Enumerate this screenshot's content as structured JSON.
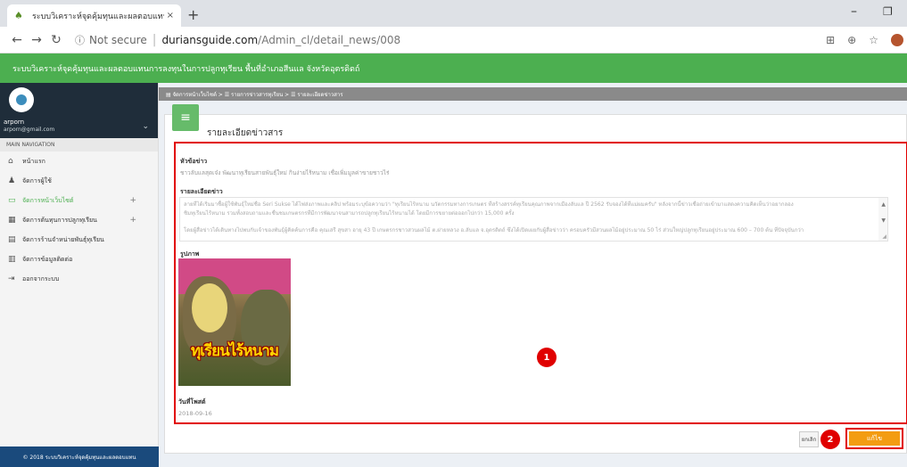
{
  "browser": {
    "tab_title": "ระบบวิเคราะห์จุดคุ้มทุนและผลตอบแทน",
    "tab_close": "×",
    "new_tab": "+",
    "not_secure": "Not secure",
    "url_host": "duriansguide.com",
    "url_path": "/Admin_cl/detail_news/008"
  },
  "app": {
    "header_title": "ระบบวิเคราะห์จุดคุ้มทุนและผลตอบแทนการลงทุนในการปลูกทุเรียน พื้นที่อำเภอสีนแล จังหวัดอุตรดิตถ์"
  },
  "user": {
    "name": "arporn",
    "email": "arporn@gmail.com"
  },
  "sidebar": {
    "menu_header": "MAIN NAVIGATION",
    "items": [
      {
        "label": "หน้าแรก",
        "icon": "home-icon",
        "glyph": "⌂"
      },
      {
        "label": "จัดการผู้ใช้",
        "icon": "user-icon",
        "glyph": "♟"
      },
      {
        "label": "จัดการหน้าเว็บไซต์",
        "icon": "window-icon",
        "glyph": "▭",
        "plus": "+"
      },
      {
        "label": "จัดการต้นทุนการปลูกทุเรียน",
        "icon": "chart-icon",
        "glyph": "▦",
        "plus": "+"
      },
      {
        "label": "จัดการร้านจำหน่ายพันธุ์ทุเรียน",
        "icon": "store-icon",
        "glyph": "▤"
      },
      {
        "label": "จัดการข้อมูลติดต่อ",
        "icon": "contact-icon",
        "glyph": "▥"
      },
      {
        "label": "ออกจากระบบ",
        "icon": "logout-icon",
        "glyph": "⇥"
      }
    ],
    "footer": "© 2018 ระบบวิเคราะห์จุดคุ้มทุนและผลตอบแทน"
  },
  "breadcrumb": {
    "text": "▤ จัดการหน้าเว็บไซต์ > ☰ รายการข่าวสารทุเรียน > ☰ รายละเอียดข่าวสาร"
  },
  "panel": {
    "icon_glyph": "≡",
    "title": "รายละเอียดข่าวสาร",
    "headline_label": "หัวข้อข่าว",
    "headline_value": "ชาวลับแลสุดเจ๋ง พัฒนาทุเรียนสายพันธุ์ใหม่ กินง่ายไร้หนาม เชื่อเพิ่มมูลค่าขายชาวไร่",
    "detail_label": "รายละเอียดข่าว",
    "detail_line1": "ลายที่ได้เริ่มมาซื้อผู้ใช้พันธุ์ใหม่ชื่อ Seri Sukse ได้ไฟส่งภาพและคลิป พร้อมระบุข้อความว่า \"ทุเรียนไร้หนาม นวัตกรรมทางการเกษตร ที่สร้างสรรค์ทุเรียนคุณภาพจากเมืองลับแล ปี 2562 รับจองได้ที่แม่ผมครับ\" หลังจากนี้ข่าวเชื่อถ่ายเข้ามาแสดงความคิดเห็นว่าอยากลอง",
    "detail_line2": "ชิมทุเรียนไร้หนาม รวมทั้งสอบถามและชื่นชมเกษตรกรที่มีการพัฒนาจนสามารถปลูกทุเรียนไร้หนามได้ โดยมีการขยายต่อออกไปกว่า 15,000 ครั้ง",
    "detail_line3": "โดยผู้สื่อข่าวได้เดินทางไปพบกับเจ้าของพันธุ์ผู้คิดค้นการคือ คุณเสรี สุขสา อายุ 43 ปี เกษตรกรชาวสวนผลไม้ ต.ฝายหลวง อ.ลับแล จ.อุตรดิตถ์ ซึ่งได้เปิดเผยกับผู้สื่อข่าวว่า ครอบครัวมีสวนผลไม้อยู่ประมาณ 50 ไร่ ส่วนใหญ่ปลูกทุเรียนอยู่ประมาณ 600 – 700 ต้น ที่ปัจจุบันกว่า",
    "image_label": "รูปภาพ",
    "image_caption": "ทุเรียนไร้หนาม",
    "date_label": "วันที่โพสต์",
    "date_value": "2018-09-16"
  },
  "buttons": {
    "cancel": "ยกเลิก",
    "edit": "แก้ไข"
  },
  "annotations": {
    "badge1": "1",
    "badge2": "2"
  }
}
